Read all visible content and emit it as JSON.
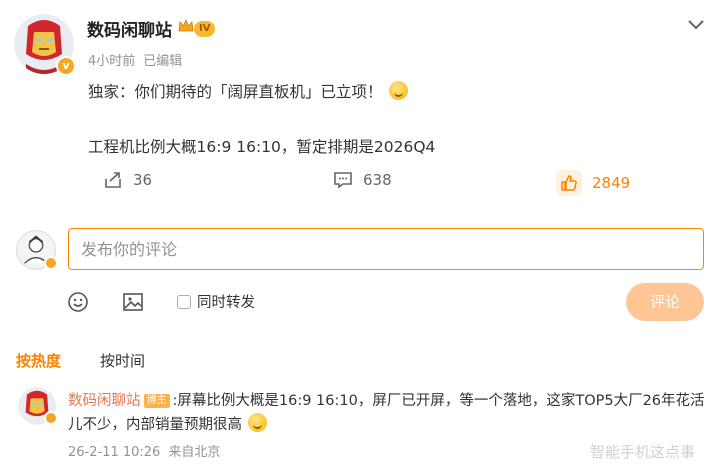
{
  "post": {
    "author": "数码闲聊站",
    "level_badge": "IV",
    "time": "4小时前",
    "edited": "已编辑",
    "line1": "独家：你们期待的「阔屏直板机」已立项！",
    "line2": "工程机比例大概16:9 16:10，暂定排期是2026Q4",
    "shares": "36",
    "comments": "638",
    "likes": "2849"
  },
  "comment_box": {
    "placeholder": "发布你的评论",
    "repost_label": "同时转发",
    "submit_label": "评论"
  },
  "sort_tabs": {
    "hot": "按热度",
    "time": "按时间"
  },
  "top_comment": {
    "author": "数码闲聊站",
    "tag": "博主",
    "text": ":屏幕比例大概是16:9 16:10，屏厂已开屏，等一个落地，这家TOP5大厂26年花活儿不少，内部销量预期很高",
    "date": "26-2-11 10:26",
    "location": "来自北京"
  },
  "watermark": "智能手机这点事",
  "colors": {
    "accent": "#ff8200",
    "submit_disabled": "#ffc695",
    "meta_gray": "#939393",
    "author_link": "#eb7350"
  },
  "icons": [
    "avatar-ironman",
    "crown-icon",
    "chevron-down-icon",
    "emoji-icon",
    "share-icon",
    "comment-icon",
    "like-icon",
    "smile-icon",
    "image-icon"
  ]
}
